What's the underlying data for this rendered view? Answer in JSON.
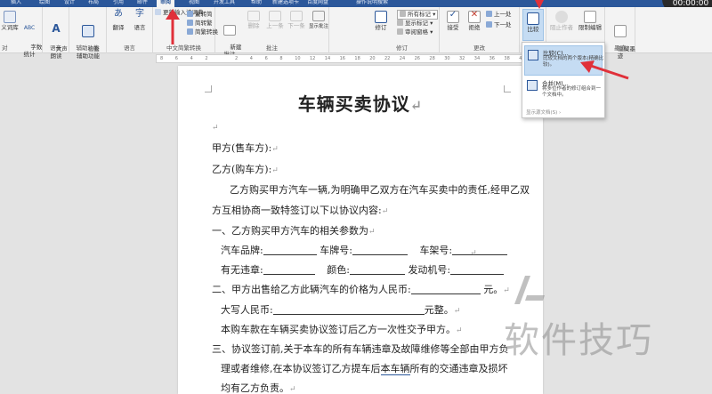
{
  "titlebar": {
    "tabs": [
      "插入",
      "绘图",
      "设计",
      "布局",
      "引用",
      "邮件",
      "审阅",
      "视图",
      "开发工具",
      "帮助",
      "新建选项卡",
      "百度网盘",
      "操作说明搜索"
    ],
    "active_tab": "审阅",
    "timer": "00:00:00"
  },
  "ribbon": {
    "proofing": {
      "thesaurus": "义词库",
      "wordcount": "字数\n统计",
      "label": "对"
    },
    "speech": {
      "readaloud": "大声\n朗读",
      "label": "语音"
    },
    "access": {
      "check": "检查\n辅助功能",
      "label": "辅助功能"
    },
    "language": {
      "translate": "翻译",
      "language": "语言",
      "label": "语言"
    },
    "chinese": {
      "to_trad": "繁转简",
      "to_simp": "简转繁",
      "convert": "简繁转换",
      "label": "中文简繁转换",
      "dict": "更新输入法词典"
    },
    "comments": {
      "new": "新建\n批注",
      "delete": "删除",
      "prev": "上一条",
      "next": "下一条",
      "show": "显示批注",
      "label": "批注"
    },
    "tracking": {
      "track": "修订",
      "markup": "所有标记",
      "show_markup": "显示标记",
      "pane": "审阅窗格",
      "label": "修订"
    },
    "changes": {
      "accept": "接受",
      "reject": "拒绝",
      "prev": "上一处",
      "next": "下一处",
      "label": "更改"
    },
    "compare": {
      "compare": "比较",
      "label": ""
    },
    "protect": {
      "block": "阻止作者",
      "restrict": "限制编辑"
    },
    "ink": {
      "hide": "隐藏墨\n迹",
      "label": "墨迹"
    }
  },
  "ruler": {
    "marks": [
      "8",
      "6",
      "4",
      "2",
      "",
      "2",
      "4",
      "6",
      "8",
      "10",
      "12",
      "14",
      "16",
      "18",
      "20",
      "22",
      "24",
      "26",
      "28",
      "30",
      "32",
      "34",
      "36",
      "38",
      "40",
      "42",
      "44",
      "46"
    ]
  },
  "compare_menu": {
    "item1_title": "比较(C)...",
    "item1_desc": "比较文档的两个版本(精确比较)。",
    "item2_title": "合并(M)...",
    "item2_desc": "将多位作者的修订组合到一个文档中。",
    "sub": "显示源文档(S)"
  },
  "document": {
    "title": "车辆买卖协议",
    "party_a": "甲方(售车方):",
    "party_b": "乙方(购车方):",
    "para1a": "乙方购买甲方汽车一辆,为明确甲乙双方在汽车买卖中的责任,经甲乙双",
    "para1b": "方互相协商一致特签订以下以协议内容:",
    "sec1": "一、乙方购买甲方汽车的相关参数为",
    "brand": "汽车品牌:",
    "plate": "车牌号:",
    "frame": "车架号:",
    "violation": "有无违章:",
    "color": "颜色:",
    "engine": "发动机号:",
    "sec2": "二、甲方出售给乙方此辆汽车的价格为人民币:",
    "sec2_end": "元。",
    "upper": "大写人民币:",
    "upper_end": "元整。",
    "pay": "本购车款在车辆买卖协议签订后乙方一次性交予甲方。",
    "sec3a": "三、协议签订前,关于本车的所有车辆违章及故障维修等全部由甲方负",
    "sec3b_1": "理或者维修,在本协议签订乙方提车后",
    "sec3b_u": "本车辆",
    "sec3b_2": "所有的交通违章及损坏",
    "sec3c": "均有乙方负责。"
  },
  "watermark": "软件技巧",
  "colors": {
    "accent": "#2b579a",
    "arrow": "#e0303a",
    "highlight": "#c5dcf3"
  }
}
